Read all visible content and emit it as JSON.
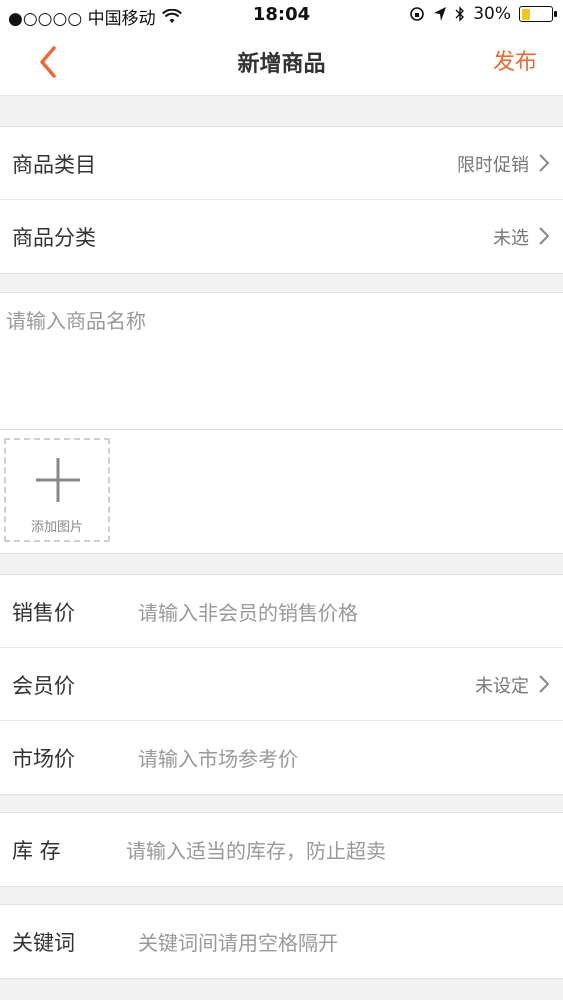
{
  "status_bar": {
    "carrier": "●○○○○ 中国移动",
    "time": "18:04",
    "battery_text": "30%",
    "battery_level": 0.3
  },
  "nav": {
    "title": "新增商品",
    "publish_label": "发布",
    "accent_color": "#e96a34"
  },
  "category_group": {
    "items": [
      {
        "label": "商品类目",
        "value": "限时促销"
      },
      {
        "label": "商品分类",
        "value": "未选"
      }
    ]
  },
  "product_name": {
    "placeholder": "请输入商品名称"
  },
  "images": {
    "add_label": "添加图片"
  },
  "price_group": {
    "sale_price": {
      "label": "销售价",
      "placeholder": "请输入非会员的销售价格"
    },
    "member_price": {
      "label": "会员价",
      "value": "未设定"
    },
    "market_price": {
      "label": "市场价",
      "placeholder": "请输入市场参考价"
    }
  },
  "stock": {
    "label": "库 存",
    "placeholder": "请输入适当的库存，防止超卖"
  },
  "keywords": {
    "label": "关键词",
    "placeholder": "关键词间请用空格隔开"
  }
}
